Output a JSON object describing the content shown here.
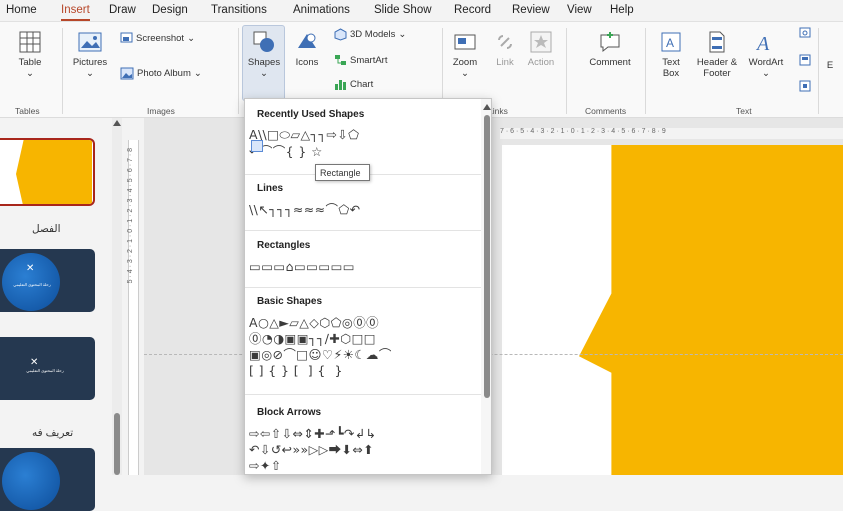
{
  "menu": {
    "tabs": [
      "Home",
      "Insert",
      "Draw",
      "Design",
      "Transitions",
      "Animations",
      "Slide Show",
      "Record",
      "Review",
      "View",
      "Help"
    ],
    "active_tab": "Insert"
  },
  "ribbon": {
    "table": "Table",
    "pictures": "Pictures",
    "screenshot": "Screenshot",
    "photo_album": "Photo Album",
    "shapes": "Shapes",
    "icons": "Icons",
    "models_3d": "3D Models",
    "smartart": "SmartArt",
    "chart": "Chart",
    "zoom": "Zoom",
    "link": "Link",
    "action": "Action",
    "comment": "Comment",
    "text_box": "Text Box",
    "header_footer": "Header & Footer",
    "wordart": "WordArt",
    "cut_label": "E",
    "groups": {
      "tables": "Tables",
      "images": "Images",
      "links": "Links",
      "comments": "Comments",
      "text": "Text"
    }
  },
  "dropdown": {
    "recent_title": "Recently Used Shapes",
    "lines_title": "Lines",
    "rectangles_title": "Rectangles",
    "basic_title": "Basic Shapes",
    "block_arrows_title": "Block Arrows",
    "recent_row1": "A\\\\□⬭▱△┐┐⇨⇩⬠",
    "recent_row2": "↶⌒⌒{ } ☆",
    "lines_row": "\\\\↖┐┐┐≈≈≈⌒⬠↶",
    "rect_row": "▭▭▭⌂▭▭▭▭▭",
    "basic_row1": "A○△►▱△◇⬡⬠◎⓪⓪",
    "basic_row2": "⓪◔◑▣▣┐┐∕✚⬡□□",
    "basic_row3": "▣◎⊘⌒□☺♡⚡☀☾☁⌒",
    "basic_row4": "[ ] { } [  ] {  }",
    "arrows_row1": "⇨⇦⇧⇩⇔⇕✚⬏┗↷↲↳",
    "arrows_row2": "↶⇩↺↩»»▷▷⮕⬇⇔⬆",
    "arrows_row3": "⇨✦⇧"
  },
  "tooltip": "Rectangle",
  "slides_panel": {
    "label_1": "الفصل",
    "label_2": "تعريف فه",
    "thumb_x": "✕",
    "thumb_text": "رحلة المحتوى التعليمي"
  },
  "ruler": {
    "horizontal": "7 · 6 · 5 · 4 · 3 · 2 · 1 · 0 · 1 · 2 · 3 · 4 · 5 · 6 · 7 · 8 · 9",
    "vertical": "5 · 4 · 3 · 2 · 1 · 0 · 1 · 2 · 3 · 4 · 5 · 6 · 7 · 8"
  },
  "colors": {
    "accent": "#b7472a",
    "slide_shape": "#f7b500",
    "thumb_bg": "#253850"
  }
}
